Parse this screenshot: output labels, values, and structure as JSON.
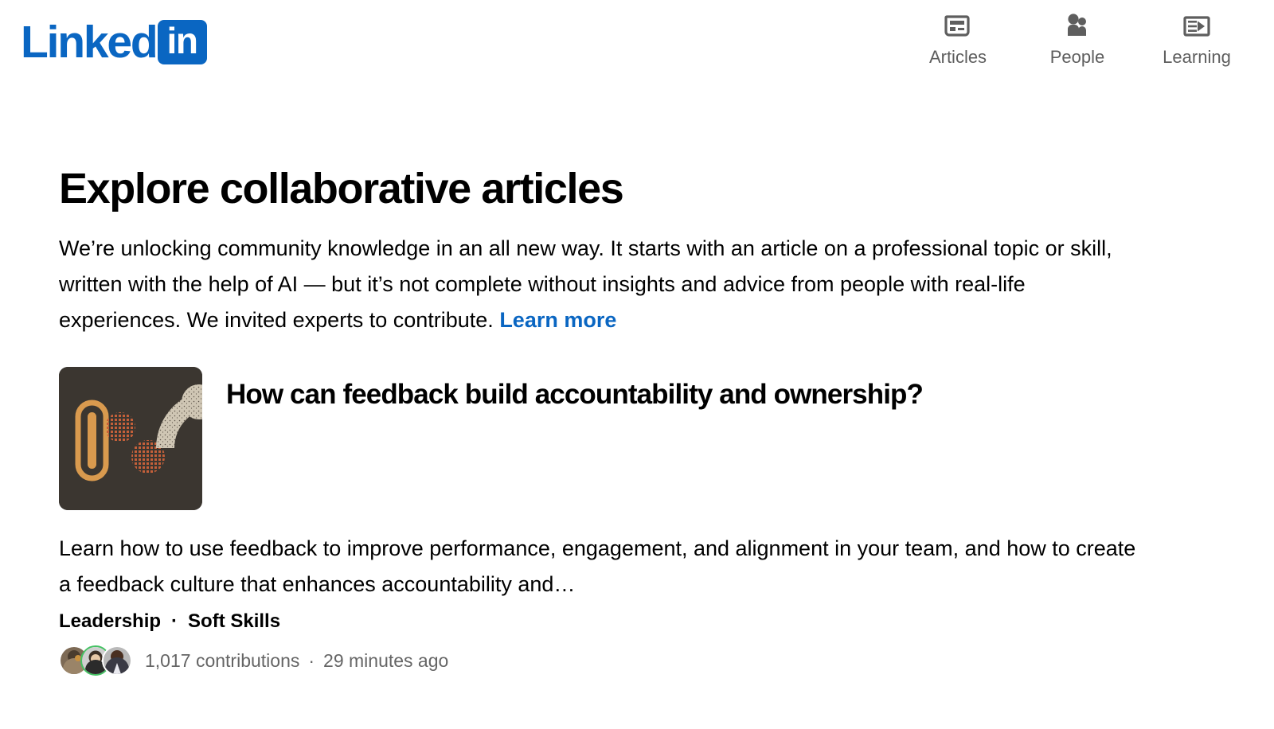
{
  "brand": {
    "name_word": "Linked",
    "name_badge": "in",
    "color": "#0a66c2"
  },
  "nav": {
    "items": [
      {
        "label": "Articles",
        "icon": "newspaper-icon"
      },
      {
        "label": "People",
        "icon": "people-icon"
      },
      {
        "label": "Learning",
        "icon": "video-lesson-icon"
      }
    ]
  },
  "page": {
    "title": "Explore collaborative articles",
    "intro": "We’re unlocking community knowledge in an all new way. It starts with an article on a professional topic or skill, written with the help of AI — but it’s not complete without insights and advice from people with real-life experiences. We invited experts to contribute.",
    "intro_link": "Learn more"
  },
  "article": {
    "title": "How can feedback build accountability and ownership?",
    "description": "Learn how to use feedback to improve performance, engagement, and alignment in your team, and how to create a feedback culture that enhances accountability and…",
    "tags": [
      "Leadership",
      "Soft Skills"
    ],
    "tag_separator": "·",
    "contributions": "1,017 contributions",
    "meta_separator": "·",
    "timestamp": "29 minutes ago",
    "thumbnail": {
      "background_color": "#3b3630",
      "accent_color": "#d99a4e",
      "dot_color": "#c4603a",
      "arc_color": "#cfc6b4"
    }
  }
}
